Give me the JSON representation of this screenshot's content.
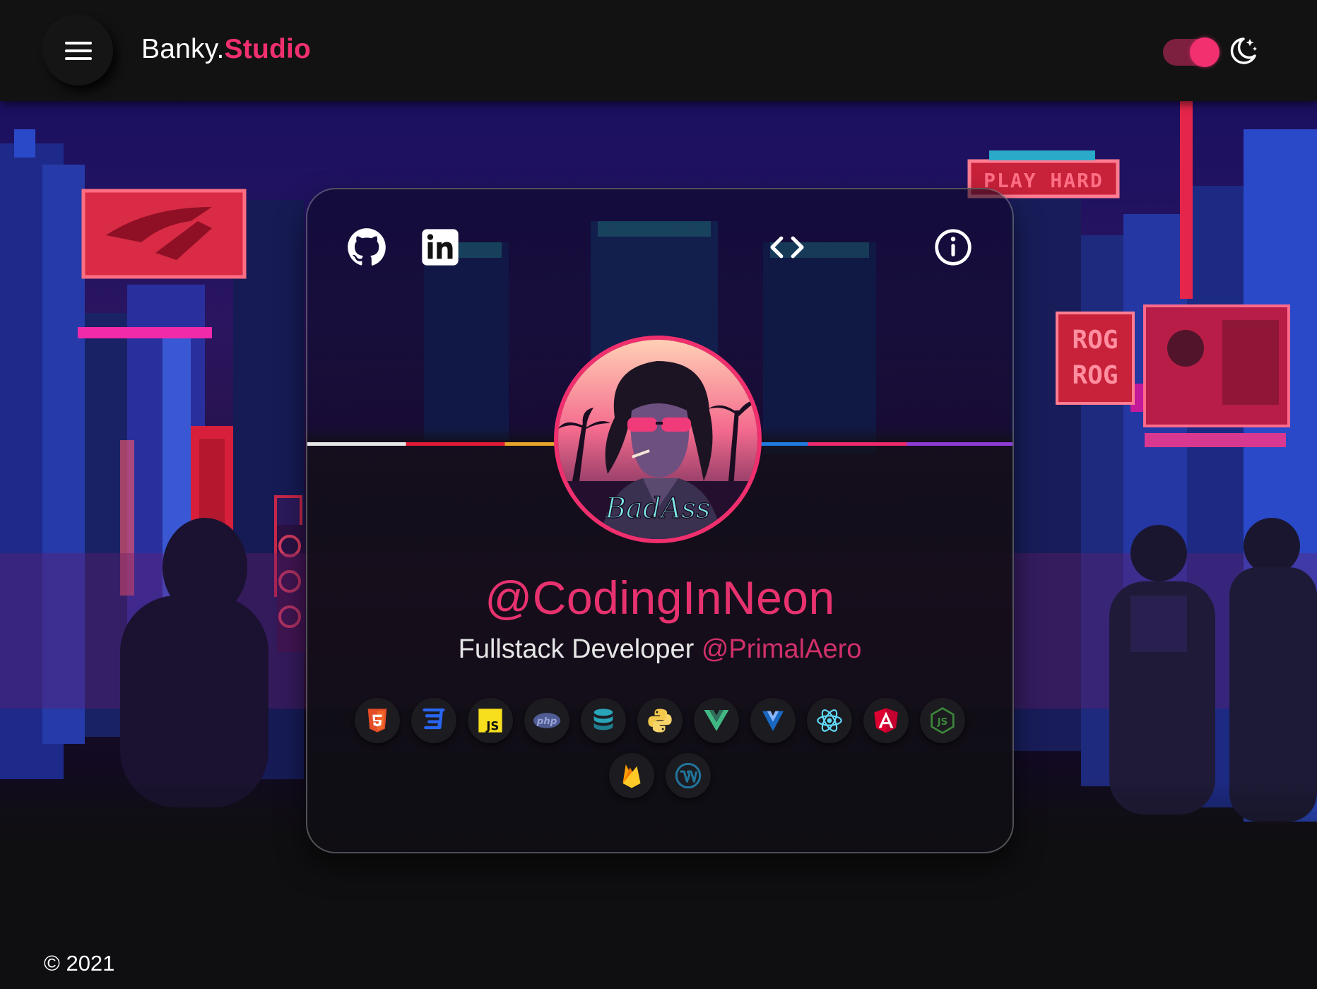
{
  "header": {
    "menu_icon": "hamburger-menu-icon",
    "brand_part1": "Banky.",
    "brand_part2": "Studio",
    "theme_toggle_on": true,
    "theme_icon": "moon-stars-icon"
  },
  "card": {
    "top_left_links": [
      {
        "icon": "github-icon"
      },
      {
        "icon": "linkedin-icon"
      }
    ],
    "top_right_links": [
      {
        "icon": "code-icon"
      },
      {
        "icon": "info-icon"
      }
    ],
    "avatar_label": "BadAss",
    "handle": "@CodingInNeon",
    "subtitle_role": "Fullstack Developer",
    "subtitle_company": "@PrimalAero",
    "skills": [
      {
        "name": "html5-icon",
        "color": "#e44d26"
      },
      {
        "name": "css3-icon",
        "color": "#2965f1"
      },
      {
        "name": "javascript-icon",
        "color": "#f7df1e",
        "label": "JS"
      },
      {
        "name": "php-icon",
        "color": "#777bb4",
        "label": "php"
      },
      {
        "name": "database-icon",
        "color": "#2aa4b8"
      },
      {
        "name": "python-icon",
        "color": "#f7c93e"
      },
      {
        "name": "vue-icon",
        "color": "#41b883"
      },
      {
        "name": "vuetify-icon",
        "color": "#1867c0"
      },
      {
        "name": "react-icon",
        "color": "#61dafb"
      },
      {
        "name": "angular-icon",
        "color": "#dd0031"
      },
      {
        "name": "nodejs-icon",
        "color": "#3c873a",
        "label": "JS"
      },
      {
        "name": "firebase-icon",
        "color": "#ffca28"
      },
      {
        "name": "wordpress-icon",
        "color": "#21759b"
      }
    ]
  },
  "scene": {
    "sign_play_hard": "PLAY HARD",
    "sign_rog_1": "ROG",
    "sign_rog_2": "ROG"
  },
  "footer": {
    "copyright": "© 2021"
  },
  "colors": {
    "accent": "#f0306e",
    "background": "#121212"
  }
}
